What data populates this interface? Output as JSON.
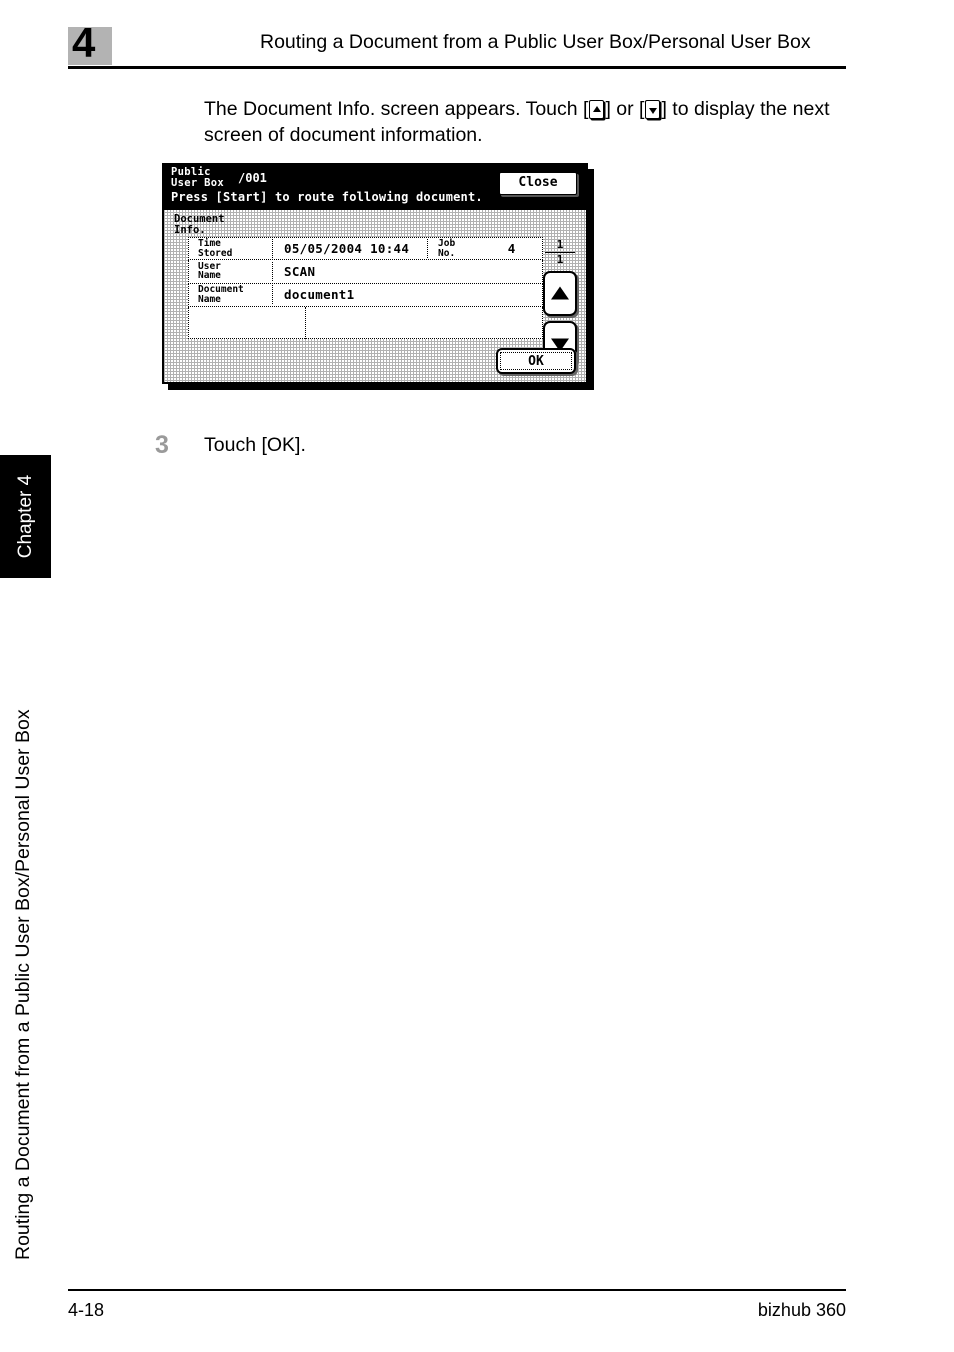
{
  "header": {
    "chapter_number": "4",
    "title": "Routing a Document from a Public User Box/Personal User Box"
  },
  "intro": {
    "text_before": "The Document Info. screen appears. Touch [",
    "text_middle": "] or [",
    "text_after": "] to display the next screen of document information."
  },
  "lcd": {
    "box_name_line1": "Public",
    "box_name_line2": "User Box",
    "box_number": "/001",
    "instruction": "Press [Start] to route following document.",
    "close_label": "Close",
    "info_title_line1": "Document",
    "info_title_line2": "Info.",
    "rows": [
      {
        "label_line1": "Time",
        "label_line2": "Stored",
        "value": "05/05/2004 10:44",
        "job_label_line1": "Job",
        "job_label_line2": "No.",
        "job_value": "4"
      },
      {
        "label_line1": "User",
        "label_line2": "Name",
        "value": "SCAN"
      },
      {
        "label_line1": "Document",
        "label_line2": "Name",
        "value": "document1"
      }
    ],
    "page_current": "1",
    "page_total": "1",
    "ok_label": "OK"
  },
  "step": {
    "number": "3",
    "text": "Touch [OK]."
  },
  "side": {
    "tab_label": "Chapter 4",
    "vertical_title": "Routing a Document from a Public User Box/Personal User Box"
  },
  "footer": {
    "page_number": "4-18",
    "product": "bizhub 360"
  }
}
